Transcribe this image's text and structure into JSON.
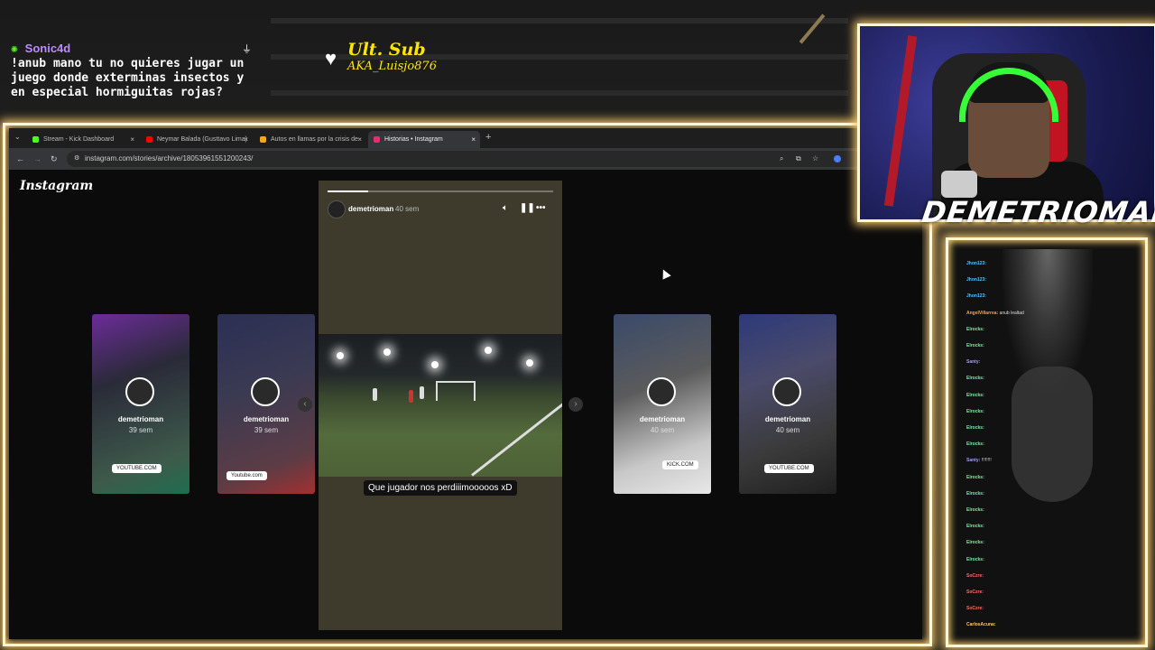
{
  "overlay": {
    "chat_user": "Sonic4d",
    "chat_text": "!anub mano tu no quieres jugar un juego donde exterminas insectos y en especial hormiguitas rojas?",
    "sub_title": "Ult. Sub",
    "sub_name": "AKA_Luisjo876",
    "streamer_name": "DEMETRIOMAN"
  },
  "browser": {
    "tabs": [
      {
        "label": "Stream - Kick Dashboard",
        "color": "#53fc18"
      },
      {
        "label": "Neymar Balada (Gusttavo Lima)",
        "color": "#ff0000"
      },
      {
        "label": "Autos en llamas por la crisis de",
        "color": "#f5a623"
      },
      {
        "label": "Historias • Instagram",
        "color": "#e1306c"
      }
    ],
    "new_tab": "+",
    "url": "instagram.com/stories/archive/18053961551200243/"
  },
  "instagram": {
    "logo": "Instagram",
    "story": {
      "username": "demetrioman",
      "time": "40 sem",
      "progress": 0.18,
      "caption": "Que jugador nos perdiiimooooos xD"
    },
    "thumbs": [
      {
        "name": "demetrioman",
        "time": "39 sem",
        "badge": "YOUTUBE.COM"
      },
      {
        "name": "demetrioman",
        "time": "39 sem",
        "badge": "Youtube.com"
      },
      {
        "name": "demetrioman",
        "time": "40 sem",
        "badge": "KICK.COM"
      },
      {
        "name": "demetrioman",
        "time": "40 sem",
        "badge": "YOUTUBE.COM"
      }
    ]
  },
  "chat_panel": {
    "lines": [
      {
        "user": "Jhon123",
        "text": "",
        "color": "#4fc3ff"
      },
      {
        "user": "Jhon123",
        "text": "",
        "color": "#4fc3ff"
      },
      {
        "user": "Jhon123",
        "text": "",
        "color": "#4fc3ff"
      },
      {
        "user": "AngelVillarrea",
        "text": "anub lealtad",
        "color": "#ff9f43"
      },
      {
        "user": "Elrocks",
        "text": "",
        "color": "#7bed9f"
      },
      {
        "user": "Elrocks",
        "text": "",
        "color": "#7bed9f"
      },
      {
        "user": "Santy",
        "text": "",
        "color": "#a29bfe"
      },
      {
        "user": "Elrocks",
        "text": "",
        "color": "#7bed9f"
      },
      {
        "user": "Elrocks",
        "text": "",
        "color": "#7bed9f"
      },
      {
        "user": "Elrocks",
        "text": "",
        "color": "#7bed9f"
      },
      {
        "user": "Elrocks",
        "text": "",
        "color": "#7bed9f"
      },
      {
        "user": "Elrocks",
        "text": "",
        "color": "#7bed9f"
      },
      {
        "user": "Santy",
        "text": "!!!!!!!!",
        "color": "#a29bfe"
      },
      {
        "user": "Elrocks",
        "text": "",
        "color": "#7bed9f"
      },
      {
        "user": "Elrocks",
        "text": "",
        "color": "#7bed9f"
      },
      {
        "user": "Elrocks",
        "text": "",
        "color": "#7bed9f"
      },
      {
        "user": "Elrocks",
        "text": "",
        "color": "#7bed9f"
      },
      {
        "user": "Elrocks",
        "text": "",
        "color": "#7bed9f"
      },
      {
        "user": "Elrocks",
        "text": "",
        "color": "#7bed9f"
      },
      {
        "user": "SoCzre",
        "text": "",
        "color": "#ff6b6b"
      },
      {
        "user": "SoCzre",
        "text": "",
        "color": "#ff6b6b"
      },
      {
        "user": "SoCzre",
        "text": "",
        "color": "#ff6b6b"
      },
      {
        "user": "CarlosAcuna",
        "text": "",
        "color": "#feca57"
      }
    ]
  }
}
